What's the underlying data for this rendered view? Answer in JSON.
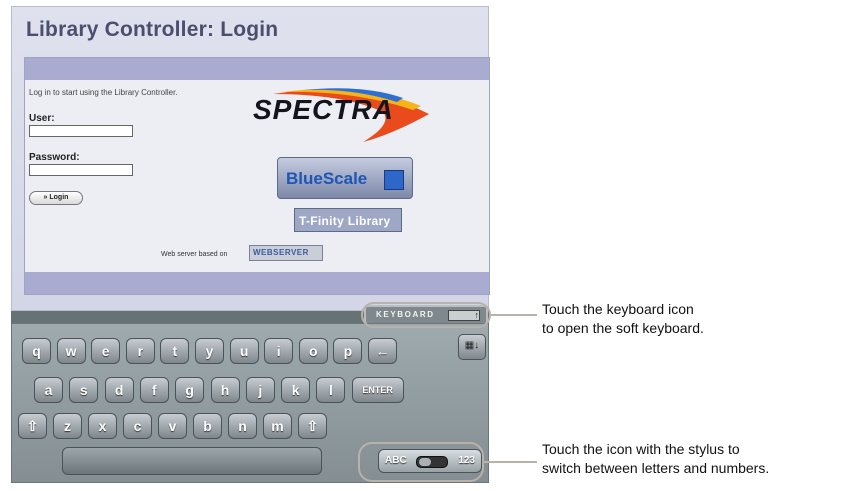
{
  "screen": {
    "title": "Library Controller: Login",
    "login": {
      "prompt": "Log in to start using the Library Controller.",
      "user_label": "User:",
      "user_value": "",
      "password_label": "Password:",
      "password_value": "",
      "login_button": "» Login"
    },
    "logos": {
      "spectra": "SPECTRA",
      "bluescale": "BlueScale",
      "tfinity": "T-Finity Library",
      "webserver_prefix": "Web server based on",
      "webserver_logo": "WEBSERVER"
    }
  },
  "keyboard_toggle": {
    "label": "KEYBOARD"
  },
  "keyboard": {
    "row1": [
      "q",
      "w",
      "e",
      "r",
      "t",
      "y",
      "u",
      "i",
      "o",
      "p",
      "←"
    ],
    "row2": [
      "a",
      "s",
      "d",
      "f",
      "g",
      "h",
      "j",
      "k",
      "l",
      "ENTER"
    ],
    "row3": [
      "⇧",
      "z",
      "x",
      "c",
      "v",
      "b",
      "n",
      "m",
      "⇧"
    ],
    "mode_left": "ABC",
    "mode_right": "123"
  },
  "callouts": {
    "keyboard_line1": "Touch the keyboard icon",
    "keyboard_line2": "to open the soft keyboard.",
    "mode_line1": "Touch the icon with the stylus to",
    "mode_line2": "switch between letters and numbers."
  },
  "colors": {
    "panel_bar": "#a9acd0",
    "title_text": "#4a4f6e",
    "bluescale_blue": "#1f55b5"
  }
}
